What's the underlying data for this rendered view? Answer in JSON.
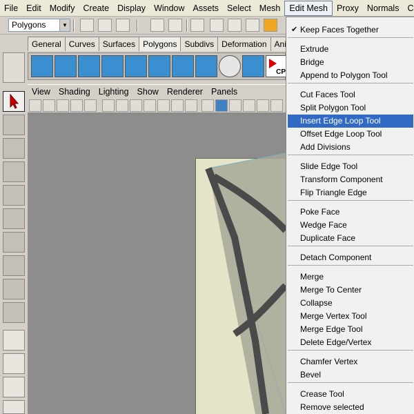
{
  "menubar": {
    "items": [
      "File",
      "Edit",
      "Modify",
      "Create",
      "Display",
      "Window",
      "Assets",
      "Select",
      "Mesh",
      "Edit Mesh",
      "Proxy",
      "Normals",
      "Co"
    ],
    "active_index": 9
  },
  "status_line": {
    "mode": "Polygons"
  },
  "shelf": {
    "tabs": [
      "General",
      "Curves",
      "Surfaces",
      "Polygons",
      "Subdivs",
      "Deformation",
      "Animation"
    ],
    "active_tab": "Polygons",
    "cp_label": "CP"
  },
  "panel": {
    "menus": [
      "View",
      "Shading",
      "Lighting",
      "Show",
      "Renderer",
      "Panels"
    ]
  },
  "dropdown": {
    "title": "Edit Mesh",
    "highlighted": "Insert Edge Loop Tool",
    "items": [
      {
        "label": "Keep Faces Together",
        "checked": true
      },
      {
        "label": "Extrude"
      },
      {
        "label": "Bridge"
      },
      {
        "label": "Append to Polygon Tool"
      },
      {
        "label": "Cut Faces Tool"
      },
      {
        "label": "Split Polygon Tool"
      },
      {
        "label": "Insert Edge Loop Tool"
      },
      {
        "label": "Offset Edge Loop Tool"
      },
      {
        "label": "Add Divisions"
      },
      {
        "label": "Slide Edge Tool"
      },
      {
        "label": "Transform Component"
      },
      {
        "label": "Flip Triangle Edge"
      },
      {
        "label": "Poke Face"
      },
      {
        "label": "Wedge Face"
      },
      {
        "label": "Duplicate Face"
      },
      {
        "label": "Detach Component"
      },
      {
        "label": "Merge"
      },
      {
        "label": "Merge To Center"
      },
      {
        "label": "Collapse"
      },
      {
        "label": "Merge Vertex Tool"
      },
      {
        "label": "Merge Edge Tool"
      },
      {
        "label": "Delete Edge/Vertex"
      },
      {
        "label": "Chamfer Vertex"
      },
      {
        "label": "Bevel"
      },
      {
        "label": "Crease Tool"
      },
      {
        "label": "Remove selected"
      }
    ]
  },
  "colors": {
    "highlight": "#316ac5",
    "menu_bg": "#f1f1ef",
    "viewport_bg": "#8d8d8d",
    "uv_bg": "#e6e4c8",
    "wire": "#4ab8d8"
  }
}
